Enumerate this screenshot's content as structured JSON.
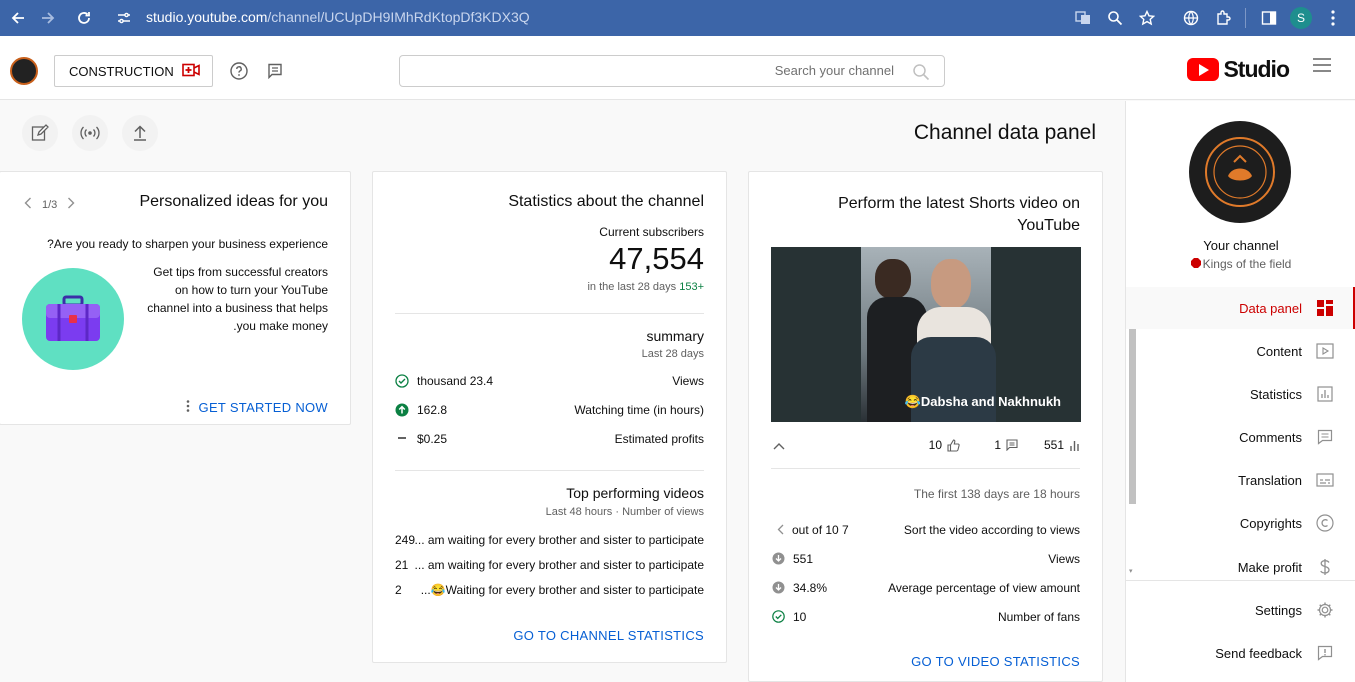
{
  "browser": {
    "url_host": "studio.youtube.com",
    "url_path": "/channel/UCUpDH9IMhRdKtopDf3KDX3Q",
    "profile_initial": "S"
  },
  "header": {
    "create_label": "CONSTRUCTION",
    "search_placeholder": "Search your channel",
    "logo_text": "Studio"
  },
  "page": {
    "title": "Channel data panel"
  },
  "ideas_card": {
    "title": "Personalized ideas for you",
    "pager": "1/3",
    "question": "?Are you ready to sharpen your business experience",
    "text_lines": [
      "Get tips from successful creators",
      "on how to turn your YouTube",
      "channel into a business that helps",
      ".you make money"
    ],
    "cta": "GET STARTED NOW"
  },
  "stats_card": {
    "title": "Statistics about the channel",
    "subs_label": "Current subscribers",
    "subs_value": "47,554",
    "subs_period": "in the last 28 days",
    "subs_change": "153+",
    "summary_title": "summary",
    "summary_period": "Last 28 days",
    "rows": [
      {
        "value": "thousand 23.4",
        "label": "Views"
      },
      {
        "value": "162.8",
        "label": "Watching time (in hours)"
      },
      {
        "value": "$0.25",
        "label": "Estimated profits"
      }
    ],
    "top_title": "Top performing videos",
    "top_sub": "Last 48 hours · Number of views",
    "top_videos": [
      {
        "count": "249",
        "title": "... am waiting for every brother and sister to participate"
      },
      {
        "count": "21",
        "title": "... am waiting for every brother and sister to participate"
      },
      {
        "count": "2",
        "title": "...😂Waiting for every brother and sister to participate"
      }
    ],
    "cta": "GO TO CHANNEL STATISTICS"
  },
  "shorts_card": {
    "title": "Perform the latest Shorts video on YouTube",
    "video_caption": "😂Dabsha and Nakhnukh",
    "likes": "10",
    "comments": "1",
    "views": "551",
    "first_days": "The first 138 days are 18 hours",
    "rank": "out of 10 7",
    "rank_label": "Sort the video according to views",
    "rows": [
      {
        "value": "551",
        "label": "Views"
      },
      {
        "value": "34.8%",
        "label": "Average percentage of view amount"
      },
      {
        "value": "10",
        "label": "Number of fans"
      }
    ],
    "cta": "GO TO VIDEO STATISTICS"
  },
  "sidebar": {
    "your_channel": "Your channel",
    "channel_name": "Kings of the field",
    "items": [
      {
        "label": "Data panel",
        "icon": "dashboard-icon"
      },
      {
        "label": "Content",
        "icon": "content-icon"
      },
      {
        "label": "Statistics",
        "icon": "analytics-icon"
      },
      {
        "label": "Comments",
        "icon": "comments-icon"
      },
      {
        "label": "Translation",
        "icon": "subtitles-icon"
      },
      {
        "label": "Copyrights",
        "icon": "copyright-icon"
      },
      {
        "label": "Make profit",
        "icon": "dollar-icon"
      }
    ],
    "settings": "Settings",
    "feedback": "Send feedback"
  },
  "colors": {
    "accent_red": "#cc0000",
    "link_blue": "#065fd4",
    "chrome_bar": "#3c65a8"
  }
}
